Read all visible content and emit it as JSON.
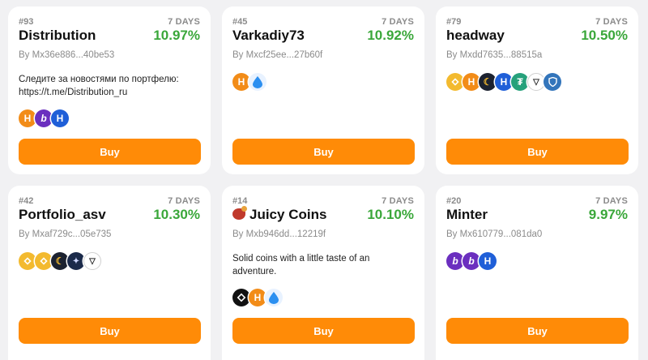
{
  "cards": [
    {
      "rank": "#93",
      "period": "7 DAYS",
      "name": "Distribution",
      "return": "10.97%",
      "by": "By Mx36e886...40be53",
      "description": "Следите за новостями по портфелю:\nhttps://t.me/Distribution_ru",
      "tokens": [
        "h-orange-icon",
        "b-purple-icon",
        "h-blue-icon"
      ],
      "buy_label": "Buy"
    },
    {
      "rank": "#45",
      "period": "7 DAYS",
      "name": "Varkadiy73",
      "return": "10.92%",
      "by": "By Mxcf25ee...27b60f",
      "description": "",
      "tokens": [
        "h-orange-icon",
        "water-drop-icon"
      ],
      "buy_label": "Buy"
    },
    {
      "rank": "#79",
      "period": "7 DAYS",
      "name": "headway",
      "return": "10.50%",
      "by": "By Mxdd7635...88515a",
      "description": "",
      "tokens": [
        "bnb-icon",
        "h-orange-icon",
        "moon-icon",
        "h-blue-icon",
        "tether-icon",
        "tron-icon",
        "shield-icon"
      ],
      "buy_label": "Buy"
    },
    {
      "rank": "#42",
      "period": "7 DAYS",
      "name": "Portfolio_asv",
      "return": "10.30%",
      "by": "By Mxaf729c...05e735",
      "description": "",
      "tokens": [
        "bnb-icon",
        "bnb-icon",
        "moon-icon",
        "stars-icon",
        "tron-icon"
      ],
      "buy_label": "Buy"
    },
    {
      "rank": "#14",
      "period": "7 DAYS",
      "name": "Juicy Coins",
      "return": "10.10%",
      "by": "By Mxb946dd...12219f",
      "description": "Solid coins with a little taste of an\nadventure.",
      "tokens": [
        "diamond-icon",
        "h-orange-icon",
        "water-drop-icon"
      ],
      "buy_label": "Buy"
    },
    {
      "rank": "#20",
      "period": "7 DAYS",
      "name": "Minter",
      "return": "9.97%",
      "by": "By Mx610779...081da0",
      "description": "",
      "tokens": [
        "b-purple-icon",
        "b-purple-icon",
        "h-blue-icon"
      ],
      "buy_label": "Buy"
    }
  ],
  "colors": {
    "accent": "#ff8b07",
    "positive": "#3aa73a",
    "muted": "#8b8b8b",
    "background": "#f1f1f3"
  }
}
